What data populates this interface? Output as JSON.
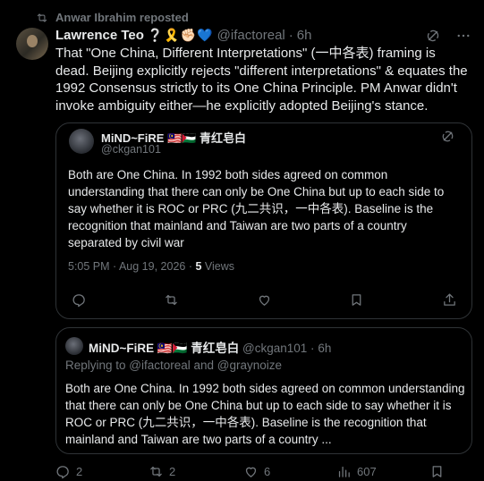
{
  "repost": {
    "label": "Anwar Ibrahim reposted",
    "icon": "repost-icon"
  },
  "tweet": {
    "author_name": "Lawrence Teo",
    "author_emojis": "❔🎗️✊🏻💙",
    "handle": "@ifactoreal",
    "separator": "·",
    "time": "6h",
    "text": "That \"One China, Different Interpretations\" (一中各表) framing is dead. Beijing explicitly rejects \"different interpretations\" & equates the 1992 Consensus strictly to its One China Principle. PM Anwar didn't invoke ambiguity either—he explicitly adopted Beijing's stance."
  },
  "quote": {
    "author_name": "MiND~FiRE 🇲🇾🇵🇸 青红皂白",
    "handle": "@ckgan101",
    "text": "Both are One China. In 1992 both sides agreed on common understanding that there can only be One China but up to each side to say whether it is ROC or PRC (九二共识，一中各表). Baseline is the recognition that mainland and Taiwan are two parts of a country separated by civil war",
    "timestamp": "5:05 PM · Aug 19, 2026 ·",
    "views_count": "5",
    "views_label": "Views"
  },
  "reply": {
    "author_name": "MiND~FiRE 🇲🇾🇵🇸 青红皂白",
    "handle": "@ckgan101",
    "separator": "·",
    "time": "6h",
    "replying_to": "Replying to @ifactoreal and @graynoize",
    "text": "Both are One China. In 1992 both sides agreed on common understanding that there can only be One China but up to each side to say whether it is ROC or PRC (九二共识，一中各表). Baseline is the recognition that mainland and Taiwan are two parts of a country ..."
  },
  "actions": {
    "replies": "2",
    "reposts": "2",
    "likes": "6",
    "views": "607"
  },
  "colors": {
    "background": "#000000",
    "text": "#e7e9ea",
    "muted": "#71767b",
    "border": "#2f3336"
  }
}
